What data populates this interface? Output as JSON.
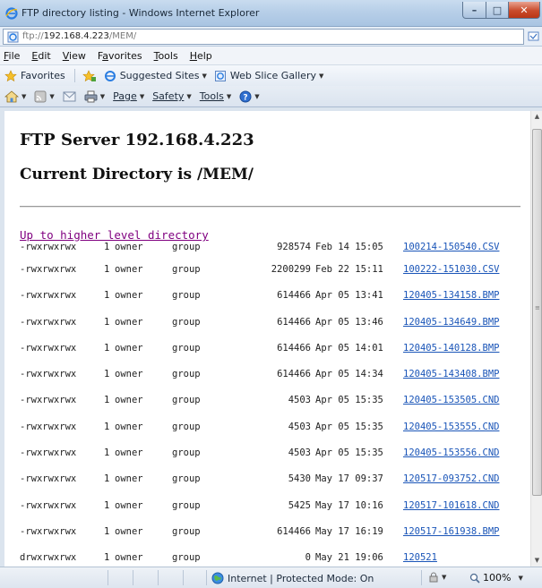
{
  "window": {
    "title": "FTP directory listing - Windows Internet Explorer",
    "address_dim": "ftp://",
    "address_bold": "192.168.4.223",
    "address_tail": "/MEM/"
  },
  "menu": [
    "File",
    "Edit",
    "View",
    "Favorites",
    "Tools",
    "Help"
  ],
  "favorites_bar": {
    "favorites": "Favorites",
    "suggested": "Suggested Sites",
    "webslice": "Web Slice Gallery"
  },
  "command_bar": {
    "page": "Page",
    "safety": "Safety",
    "tools": "Tools"
  },
  "content": {
    "heading": "FTP Server 192.168.4.223",
    "subheading": "Current Directory is /MEM/",
    "up_link": "Up to higher level directory",
    "entries": [
      {
        "perm": "-rwxrwxrwx",
        "links": "1",
        "owner": "owner",
        "group": "group",
        "size": "928574",
        "date": "Feb 14 15:05",
        "name": "100214-150540.CSV"
      },
      {
        "perm": "-rwxrwxrwx",
        "links": "1",
        "owner": "owner",
        "group": "group",
        "size": "2200299",
        "date": "Feb 22 15:11",
        "name": "100222-151030.CSV"
      },
      {
        "perm": "-rwxrwxrwx",
        "links": "1",
        "owner": "owner",
        "group": "group",
        "size": "614466",
        "date": "Apr 05 13:41",
        "name": "120405-134158.BMP"
      },
      {
        "perm": "-rwxrwxrwx",
        "links": "1",
        "owner": "owner",
        "group": "group",
        "size": "614466",
        "date": "Apr 05 13:46",
        "name": "120405-134649.BMP"
      },
      {
        "perm": "-rwxrwxrwx",
        "links": "1",
        "owner": "owner",
        "group": "group",
        "size": "614466",
        "date": "Apr 05 14:01",
        "name": "120405-140128.BMP"
      },
      {
        "perm": "-rwxrwxrwx",
        "links": "1",
        "owner": "owner",
        "group": "group",
        "size": "614466",
        "date": "Apr 05 14:34",
        "name": "120405-143408.BMP"
      },
      {
        "perm": "-rwxrwxrwx",
        "links": "1",
        "owner": "owner",
        "group": "group",
        "size": "4503",
        "date": "Apr 05 15:35",
        "name": "120405-153505.CND"
      },
      {
        "perm": "-rwxrwxrwx",
        "links": "1",
        "owner": "owner",
        "group": "group",
        "size": "4503",
        "date": "Apr 05 15:35",
        "name": "120405-153555.CND"
      },
      {
        "perm": "-rwxrwxrwx",
        "links": "1",
        "owner": "owner",
        "group": "group",
        "size": "4503",
        "date": "Apr 05 15:35",
        "name": "120405-153556.CND"
      },
      {
        "perm": "-rwxrwxrwx",
        "links": "1",
        "owner": "owner",
        "group": "group",
        "size": "5430",
        "date": "May 17 09:37",
        "name": "120517-093752.CND"
      },
      {
        "perm": "-rwxrwxrwx",
        "links": "1",
        "owner": "owner",
        "group": "group",
        "size": "5425",
        "date": "May 17 10:16",
        "name": "120517-101618.CND"
      },
      {
        "perm": "-rwxrwxrwx",
        "links": "1",
        "owner": "owner",
        "group": "group",
        "size": "614466",
        "date": "May 17 16:19",
        "name": "120517-161938.BMP"
      },
      {
        "perm": "drwxrwxrwx",
        "links": "1",
        "owner": "owner",
        "group": "group",
        "size": "0",
        "date": "May 21 19:06",
        "name": "120521"
      }
    ]
  },
  "status_bar": {
    "zone": "Internet | Protected Mode: On",
    "zoom": "100%"
  }
}
